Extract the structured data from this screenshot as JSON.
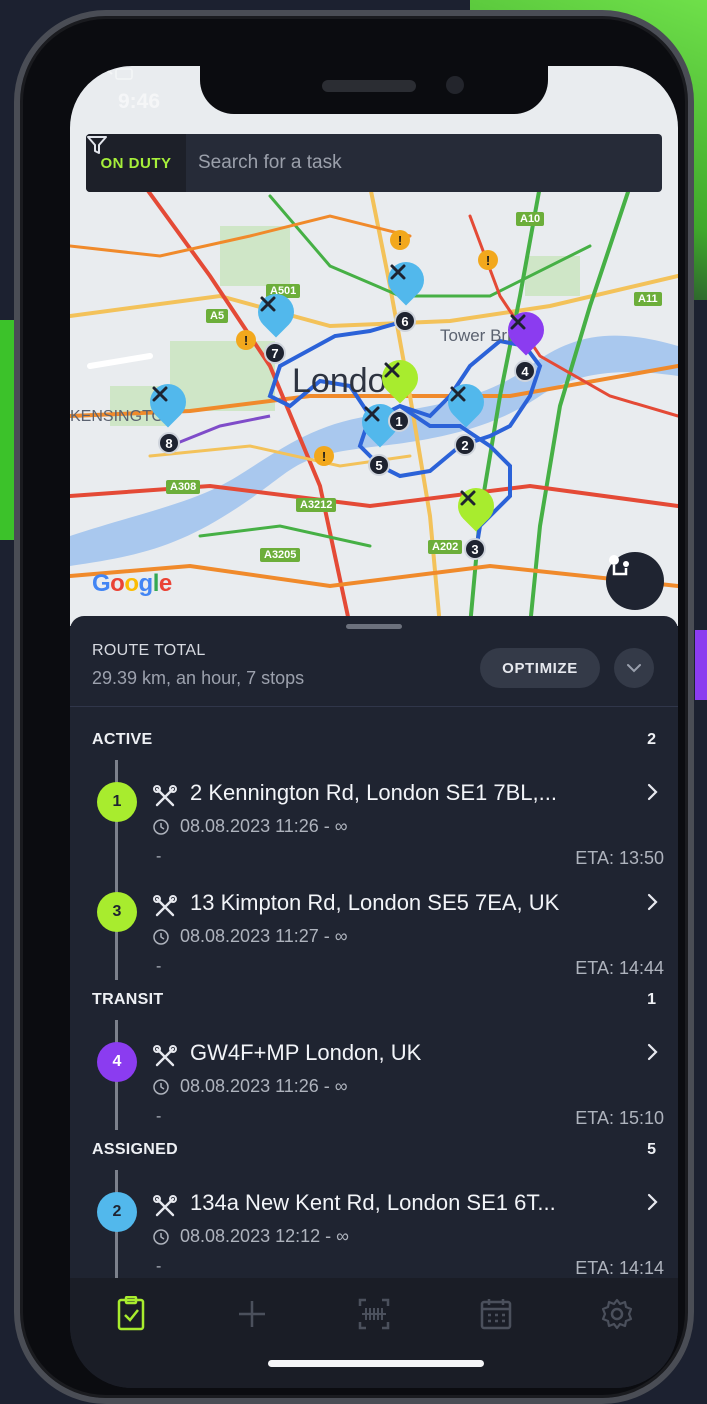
{
  "status_bar": {
    "time": "9:46"
  },
  "header": {
    "duty_status": "ON DUTY",
    "search_placeholder": "Search for a task"
  },
  "map": {
    "city_label": "London",
    "area_label": "KENSINGTON",
    "landmark_label": "Tower Bridge",
    "road_tags": [
      "A501",
      "A5",
      "A10",
      "A11",
      "A308",
      "A3212",
      "A3205",
      "A202"
    ],
    "attribution": "Google",
    "stop_numbers": [
      "1",
      "2",
      "3",
      "4",
      "5",
      "6",
      "7",
      "8"
    ],
    "alert_glyph": "!",
    "colors": {
      "active": "#a8ec2e",
      "transit": "#8b3cf0",
      "assigned": "#52b8ec",
      "route": "#2b62d8"
    }
  },
  "route": {
    "title": "ROUTE TOTAL",
    "summary": "29.39 km, an hour, 7 stops",
    "optimize_label": "OPTIMIZE"
  },
  "sections": [
    {
      "title": "ACTIVE",
      "count": "2",
      "color": "#a8ec2e",
      "tasks": [
        {
          "number": "1",
          "address": "2 Kennington Rd, London SE1 7BL,...",
          "time": "08.08.2023 11:26 - ∞",
          "note": "-",
          "eta": "ETA: 13:50"
        },
        {
          "number": "3",
          "address": "13 Kimpton Rd, London SE5 7EA, UK",
          "time": "08.08.2023 11:27 - ∞",
          "note": "-",
          "eta": "ETA: 14:44"
        }
      ]
    },
    {
      "title": "TRANSIT",
      "count": "1",
      "color": "#8b3cf0",
      "tasks": [
        {
          "number": "4",
          "address": "GW4F+MP London, UK",
          "time": "08.08.2023 11:26 - ∞",
          "note": "-",
          "eta": "ETA: 15:10"
        }
      ]
    },
    {
      "title": "ASSIGNED",
      "count": "5",
      "color": "#52b8ec",
      "tasks": [
        {
          "number": "2",
          "address": "134a New Kent Rd, London SE1 6T...",
          "time": "08.08.2023 12:12 - ∞",
          "note": "-",
          "eta": "ETA: 14:14"
        }
      ]
    }
  ],
  "tabs": [
    {
      "icon": "task-list-icon",
      "active": true
    },
    {
      "icon": "plus-icon",
      "active": false
    },
    {
      "icon": "barcode-scan-icon",
      "active": false
    },
    {
      "icon": "calendar-icon",
      "active": false
    },
    {
      "icon": "gear-icon",
      "active": false
    }
  ]
}
